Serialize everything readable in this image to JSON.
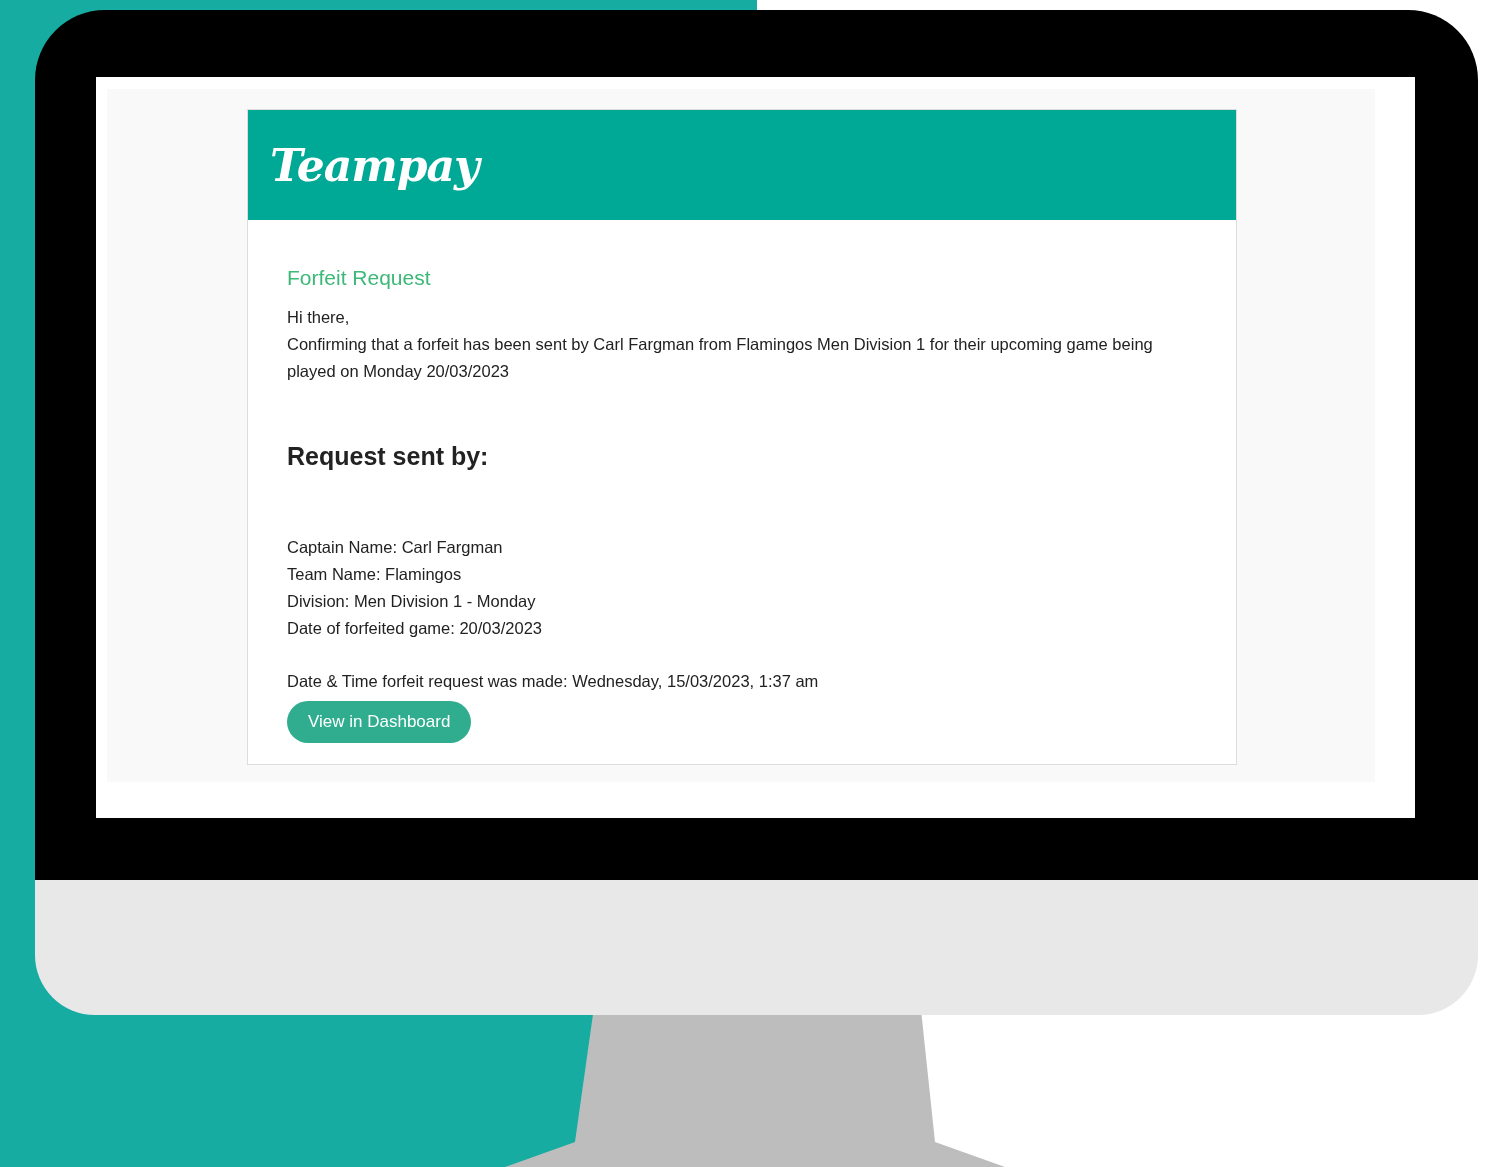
{
  "email": {
    "logo": "Teampay",
    "title": "Forfeit Request",
    "greeting": "Hi there,",
    "message": "Confirming that a forfeit has been sent by Carl Fargman from Flamingos Men Division 1 for their upcoming game being played on Monday 20/03/2023",
    "heading": "Request sent by:",
    "details": [
      "Captain Name: Carl Fargman",
      "Team Name: Flamingos",
      "Division: Men Division 1 - Monday",
      "Date of forfeited game: 20/03/2023"
    ],
    "timestamp": "Date & Time forfeit request was made: Wednesday, 15/03/2023, 1:37 am",
    "button": "View in Dashboard"
  }
}
